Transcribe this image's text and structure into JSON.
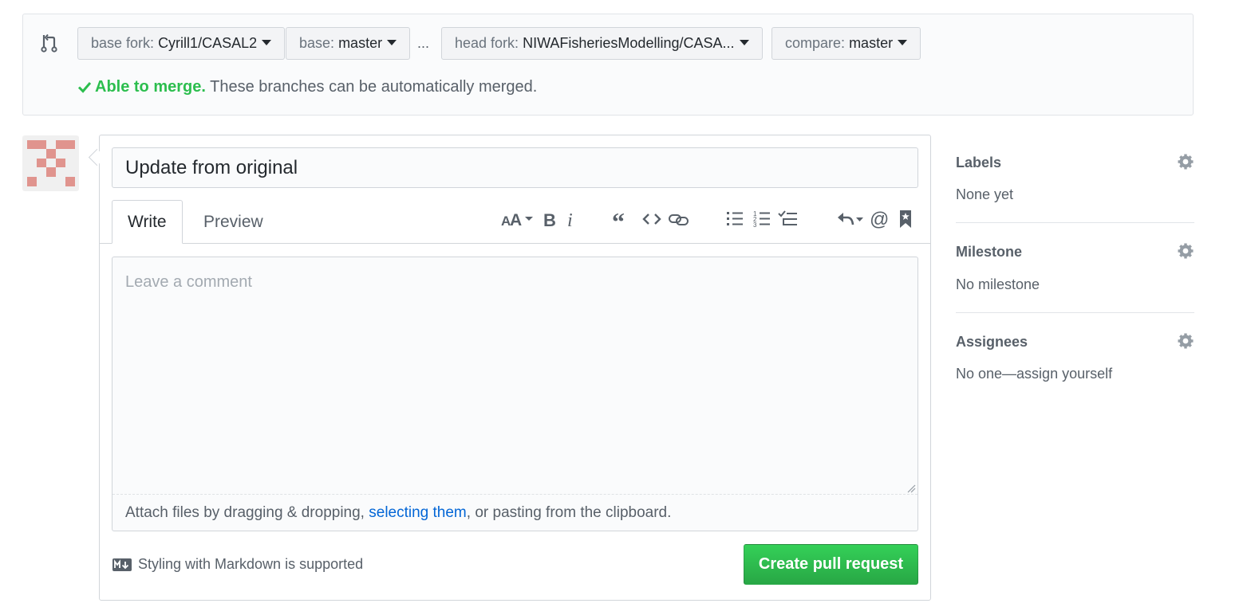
{
  "compare": {
    "base_fork": {
      "prefix": "base fork:",
      "value": "Cyrill1/CASAL2"
    },
    "base": {
      "prefix": "base:",
      "value": "master"
    },
    "ellipsis": "...",
    "head_fork": {
      "prefix": "head fork:",
      "value": "NIWAFisheriesModelling/CASA..."
    },
    "compare": {
      "prefix": "compare:",
      "value": "master"
    },
    "merge_status": {
      "ok": "Able to merge.",
      "desc": "These branches can be automatically merged."
    }
  },
  "form": {
    "title_value": "Update from original",
    "tabs": [
      {
        "label": "Write"
      },
      {
        "label": "Preview"
      }
    ],
    "toolbar_icons": [
      "text-size-icon",
      "bold-icon",
      "italic-icon",
      "quote-icon",
      "code-icon",
      "link-icon",
      "bulleted-list-icon",
      "numbered-list-icon",
      "task-list-icon",
      "reply-icon",
      "mention-icon",
      "bookmark-icon"
    ],
    "comment_placeholder": "Leave a comment",
    "attach": {
      "before": "Attach files by dragging & dropping, ",
      "link": "selecting them",
      "after": ", or pasting from the clipboard."
    },
    "markdown_note": "Styling with Markdown is supported",
    "submit_label": "Create pull request"
  },
  "sidebar": {
    "labels": {
      "heading": "Labels",
      "value": "None yet"
    },
    "milestone": {
      "heading": "Milestone",
      "value": "No milestone"
    },
    "assignees": {
      "heading": "Assignees",
      "value": "No one—assign yourself"
    }
  },
  "colors": {
    "success": "#2cbe4e",
    "link": "#0366d6",
    "button_green": "#28a745",
    "avatar": "#e0948e"
  }
}
